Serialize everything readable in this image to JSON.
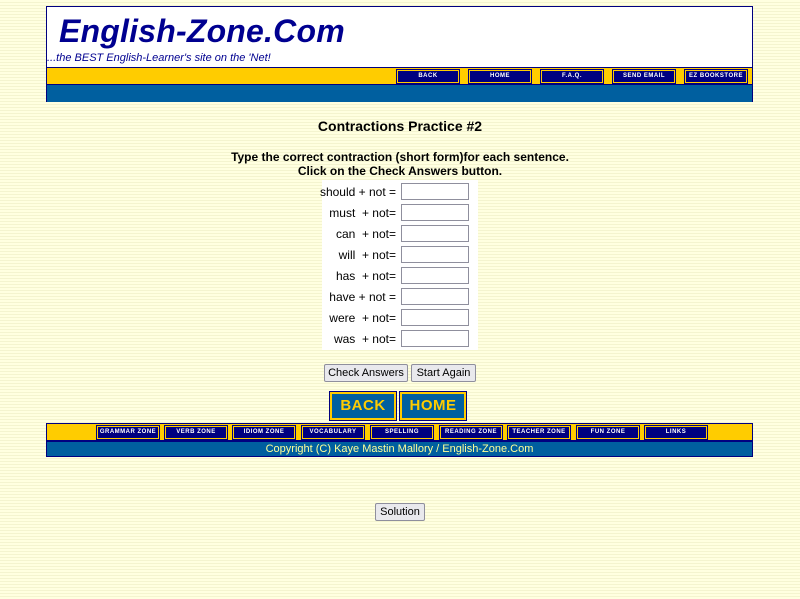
{
  "site": {
    "title": "English-Zone.Com",
    "tagline": "...the BEST English-Learner's site on the 'Net!"
  },
  "top_nav": [
    "BACK",
    "HOME",
    "F.A.Q.",
    "SEND EMAIL",
    "EZ BOOKSTORE"
  ],
  "page": {
    "heading": "Contractions Practice #2",
    "instruction_1": "Type the correct contraction (short form)for each sentence.",
    "instruction_2": "Click on the Check Answers button."
  },
  "quiz": {
    "rows": [
      {
        "label": "should + not =",
        "value": ""
      },
      {
        "label": "must  + not=",
        "value": ""
      },
      {
        "label": "can  + not=",
        "value": ""
      },
      {
        "label": "will  + not=",
        "value": ""
      },
      {
        "label": "has  + not=",
        "value": ""
      },
      {
        "label": "have + not =",
        "value": ""
      },
      {
        "label": "were  + not=",
        "value": ""
      },
      {
        "label": "was  + not=",
        "value": ""
      }
    ]
  },
  "buttons": {
    "check": "Check Answers",
    "again": "Start Again",
    "back": "BACK",
    "home": "HOME",
    "solution": "Solution"
  },
  "bottom_nav": [
    "GRAMMAR ZONE",
    "VERB ZONE",
    "IDIOM ZONE",
    "VOCABULARY",
    "SPELLING",
    "READING ZONE",
    "TEACHER ZONE",
    "FUN ZONE",
    "LINKS"
  ],
  "footer": {
    "copyright": "Copyright (C) Kaye Mastin Mallory / English-Zone.Com"
  },
  "colors": {
    "background": "#ffffe0",
    "navy": "#000080",
    "gold": "#ffcc00",
    "blue": "#005f9f"
  }
}
